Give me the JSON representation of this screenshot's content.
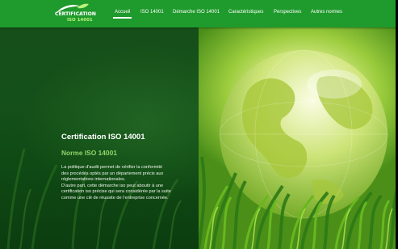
{
  "logo": {
    "main": "CERTIFICATION",
    "sub": "ISO 14001",
    "accent_color": "#b9f27a"
  },
  "nav": {
    "items": [
      {
        "label": "Accueil",
        "active": true
      },
      {
        "label": "ISO 14001",
        "active": false
      },
      {
        "label": "Démarche ISO 14001",
        "active": false
      },
      {
        "label": "Caractéristiques",
        "active": false
      },
      {
        "label": "Perspectives",
        "active": false
      },
      {
        "label": "Autres normes",
        "active": false
      }
    ],
    "bar_color": "#1f9a2c"
  },
  "hero": {
    "title": "Certification ISO 14001",
    "subtitle": "Norme ISO 14001",
    "subtitle_color": "#90d36a",
    "paragraph": "La politique d'audit permet de vérifier la conformité\ndes procédés optés par un département précis aux\nréglementations internationales.\nD'autre part, cette démarche iso peut aboutir à une\ncertification iso précise qui sera considérée par la suite\ncomme une clé de réussite de l'entreprise concernée.",
    "image": "glass-globe-on-grass"
  }
}
